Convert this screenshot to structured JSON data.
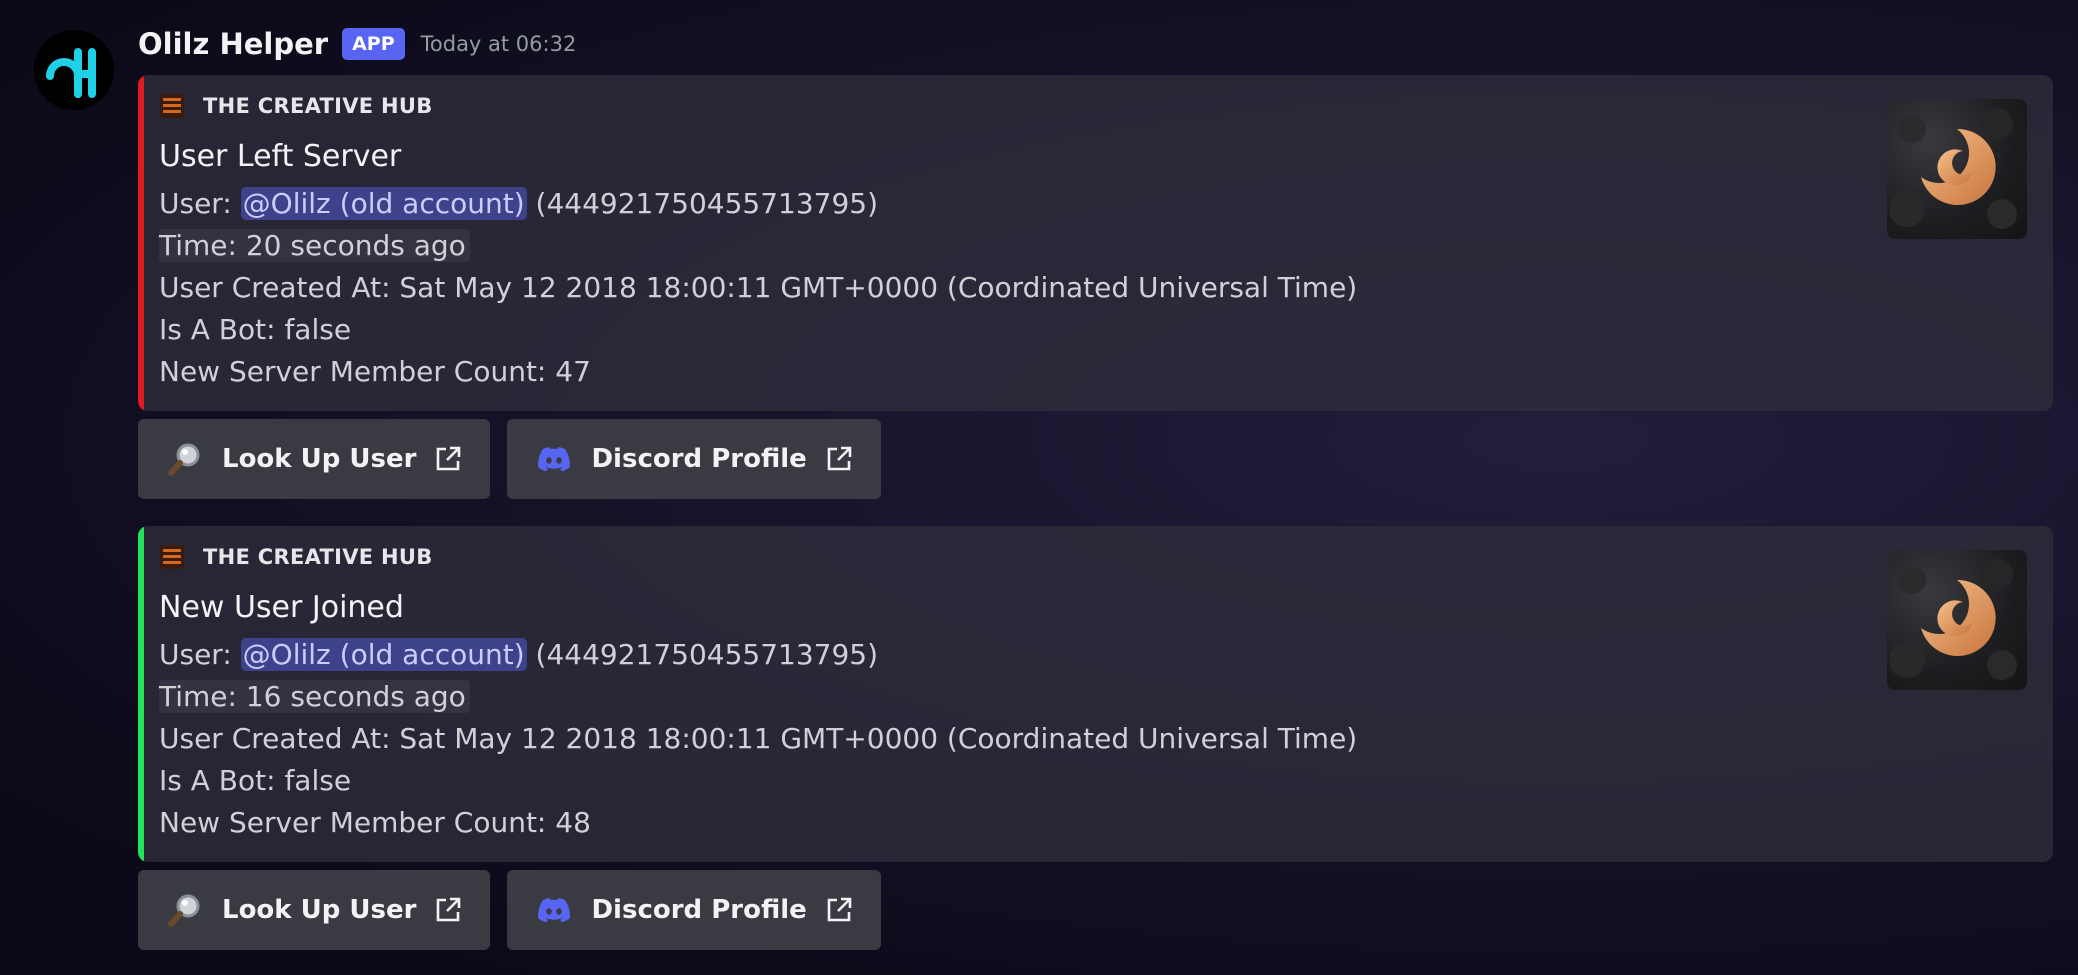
{
  "message": {
    "author": "Olilz Helper",
    "app_tag": "APP",
    "timestamp": "Today at 06:32"
  },
  "colors": {
    "accent": "#5865f2",
    "left_bar": "#e01b24",
    "join_bar": "#22e35c"
  },
  "embeds": [
    {
      "author": "THE CREATIVE HUB",
      "title": "User Left Server",
      "user_label": "User: ",
      "user_mention": "@Olilz (old account)",
      "user_id": " (444921750455713795)",
      "time": "Time: 20 seconds ago",
      "created": "User Created At: Sat May 12 2018 18:00:11 GMT+0000 (Coordinated Universal Time)",
      "is_bot": "Is A Bot: false",
      "member_count": "New Server Member Count: 47",
      "bar_color": "red"
    },
    {
      "author": "THE CREATIVE HUB",
      "title": "New User Joined",
      "user_label": "User: ",
      "user_mention": "@Olilz (old account)",
      "user_id": " (444921750455713795)",
      "time": "Time: 16 seconds ago",
      "created": "User Created At: Sat May 12 2018 18:00:11 GMT+0000 (Coordinated Universal Time)",
      "is_bot": "Is A Bot: false",
      "member_count": "New Server Member Count: 48",
      "bar_color": "green"
    }
  ],
  "buttons": {
    "lookup_label": "Look Up User",
    "lookup_icon": "magnifying-glass-icon",
    "profile_label": "Discord Profile",
    "profile_icon": "discord-logo-icon",
    "external_icon": "external-link-icon"
  }
}
